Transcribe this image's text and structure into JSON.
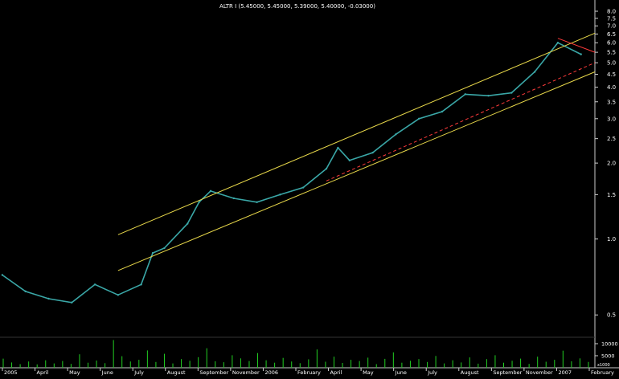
{
  "chart_data": {
    "type": "line",
    "title": "ALTR I (5.45000, 5.45000, 5.39000, 5.40000, -0.03000)",
    "y_scale": "log",
    "ylim": [
      0.42,
      8.0
    ],
    "y_ticks": [
      {
        "value": 8.0,
        "label": "8.0"
      },
      {
        "value": 7.5,
        "label": "7.5"
      },
      {
        "value": 7.0,
        "label": "7.0"
      },
      {
        "value": 6.5,
        "label": "6.5"
      },
      {
        "value": 6.0,
        "label": "6.0"
      },
      {
        "value": 5.5,
        "label": "5.5"
      },
      {
        "value": 5.0,
        "label": "5.0"
      },
      {
        "value": 4.5,
        "label": "4.5"
      },
      {
        "value": 4.0,
        "label": "4.0"
      },
      {
        "value": 3.5,
        "label": "3.5"
      },
      {
        "value": 3.0,
        "label": "3.0"
      },
      {
        "value": 2.5,
        "label": "2.5"
      },
      {
        "value": 2.0,
        "label": "2.0"
      },
      {
        "value": 1.5,
        "label": "1.5"
      },
      {
        "value": 1.0,
        "label": "1.0"
      },
      {
        "value": 0.5,
        "label": "0.5"
      }
    ],
    "x_months": [
      "2005",
      "April",
      "May",
      "June",
      "July",
      "August",
      "September",
      "November",
      "2006",
      "February",
      "April",
      "May",
      "June",
      "July",
      "August",
      "September",
      "November",
      "2007",
      "February"
    ],
    "price": {
      "x": [
        "2005-02",
        "2005-03",
        "2005-04",
        "2005-05",
        "2005-06",
        "2005-07",
        "2005-08",
        "2005-08",
        "2005-09",
        "2005-10",
        "2005-10",
        "2005-11",
        "2005-12",
        "2006-01",
        "2006-02",
        "2006-03",
        "2006-04",
        "2006-04",
        "2006-05",
        "2006-06",
        "2006-07",
        "2006-08",
        "2006-09",
        "2006-10",
        "2006-11",
        "2006-12",
        "2007-01",
        "2007-02",
        "2007-03"
      ],
      "y": [
        0.72,
        0.62,
        0.58,
        0.56,
        0.66,
        0.6,
        0.66,
        0.88,
        0.92,
        1.15,
        1.4,
        1.55,
        1.45,
        1.4,
        1.5,
        1.6,
        1.9,
        2.3,
        2.05,
        2.2,
        2.6,
        3.0,
        3.2,
        3.75,
        3.7,
        3.8,
        4.6,
        6.0,
        5.4
      ]
    },
    "volume": {
      "ylim": [
        0,
        12000
      ],
      "y_ticks": [
        {
          "value": 10000,
          "label": "10000"
        },
        {
          "value": 5000,
          "label": "5000"
        }
      ],
      "unit_label": "x1000",
      "values": [
        3800,
        2200,
        1500,
        2600,
        1400,
        3100,
        1800,
        2800,
        1600,
        5600,
        2100,
        3000,
        1900,
        11500,
        4800,
        2600,
        3300,
        7200,
        2400,
        5800,
        1800,
        3600,
        2900,
        4400,
        8100,
        2700,
        2300,
        5200,
        3900,
        2800,
        6100,
        3100,
        2100,
        4100,
        2600,
        1900,
        3500,
        7600,
        2500,
        4600,
        2000,
        3300,
        2800,
        4200,
        1500,
        3700,
        6400,
        2100,
        2900,
        3600,
        2400,
        4900,
        1800,
        3100,
        2200,
        4300,
        1700,
        3600,
        5200,
        2100,
        2900,
        3800,
        1600,
        4600,
        2500,
        3300,
        7100,
        2700,
        3900,
        2400
      ]
    },
    "trendlines": [
      {
        "name": "upper-channel",
        "color": "#e8d84a",
        "dash": "solid",
        "from": [
          "2005-07",
          1.04
        ],
        "to": [
          "2007-03",
          6.55
        ]
      },
      {
        "name": "lower-channel",
        "color": "#e8d84a",
        "dash": "solid",
        "from": [
          "2005-07",
          0.75
        ],
        "to": [
          "2007-03",
          4.6
        ]
      },
      {
        "name": "support-dashed",
        "color": "#ff3b3b",
        "dash": "dashed",
        "from": [
          "2006-04",
          1.7
        ],
        "to": [
          "2007-03",
          5.0
        ]
      },
      {
        "name": "resistance-short",
        "color": "#ff3b3b",
        "dash": "solid",
        "from": [
          "2007-02",
          6.25
        ],
        "to": [
          "2007-03",
          5.5
        ]
      }
    ],
    "colors": {
      "background": "#000000",
      "price": "#3aa7a7",
      "volume": "#22d022",
      "text": "#ffffff",
      "axis_border": "#cccccc"
    }
  }
}
